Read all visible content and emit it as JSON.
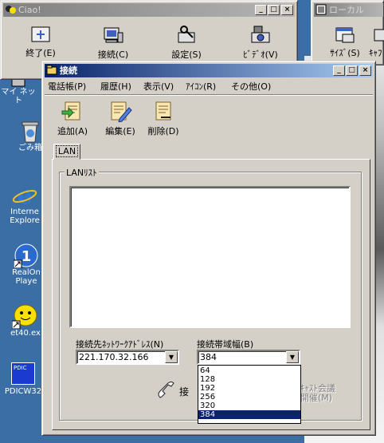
{
  "desktop": {
    "icons": [
      {
        "label": "マイ ネット"
      },
      {
        "label": "ごみ箱"
      },
      {
        "label": "Interne Explore"
      },
      {
        "label": "RealOn Playe"
      },
      {
        "label": "et40.ex"
      },
      {
        "label": "PDICW32"
      }
    ],
    "pdic_badge": "PDIC"
  },
  "ciao_window": {
    "title": "Ciao!",
    "toolbar": [
      {
        "label": "終了(E)"
      },
      {
        "label": "接続(C)"
      },
      {
        "label": "設定(S)"
      },
      {
        "label": "ﾋﾞﾃﾞｵ(V)"
      }
    ]
  },
  "local_window": {
    "title": "ローカル",
    "toolbar": [
      {
        "label": "ｻｲｽﾞ(S)"
      },
      {
        "label": "ｷｬﾌ"
      }
    ]
  },
  "main_window": {
    "title": "接続",
    "menu": [
      "電話帳(P)",
      "履歴(H)",
      "表示(V)",
      "ｱｲｺﾝ(R)",
      "その他(O)"
    ],
    "toolbar": [
      {
        "label": "追加(A)"
      },
      {
        "label": "編集(E)"
      },
      {
        "label": "削除(D)"
      }
    ],
    "tab_label": "LAN",
    "group_label": "LANﾘｽﾄ",
    "address_label": "接続先ﾈｯﾄﾜｰｸｱﾄﾞﾚｽ(N)",
    "address_value": "221.170.32.166",
    "bandwidth_label": "接続帯域幅(B)",
    "bandwidth_value": "384",
    "bandwidth_options": [
      "64",
      "128",
      "192",
      "256",
      "320",
      "384"
    ],
    "bandwidth_selected": "384",
    "connect_button": "接",
    "broadcast_line1": "ｷｬｽﾄ会議",
    "broadcast_line2": "開催(M)"
  },
  "colors": {
    "desktop": "#3a6ea5",
    "active_title": "#0a246a",
    "inactive_title": "#808080",
    "face": "#d4d0c8",
    "selection": "#0a246a"
  }
}
